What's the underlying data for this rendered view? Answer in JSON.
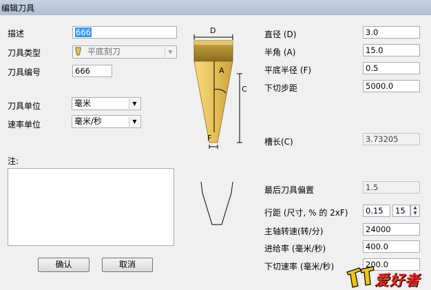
{
  "window": {
    "title": "编辑刀具"
  },
  "left": {
    "desc_label": "描述",
    "desc_value": "666",
    "type_label": "刀具类型",
    "type_value": "平底刻刀",
    "number_label": "刀具编号",
    "number_value": "666",
    "unit_label": "刀具单位",
    "unit_value": "毫米",
    "rate_unit_label": "速率单位",
    "rate_unit_value": "毫米/秒",
    "notes_label": "注:",
    "ok_label": "确认",
    "cancel_label": "取消"
  },
  "diagram": {
    "label_d": "D",
    "label_a": "A",
    "label_c": "C",
    "label_f": "F",
    "colors": {
      "tool_body": "#e8c25a",
      "tool_dark": "#b8962e",
      "line": "#000000"
    }
  },
  "right": {
    "diameter_label": "直径 (D)",
    "diameter_value": "3.0",
    "half_angle_label": "半角 (A)",
    "half_angle_value": "15.0",
    "flat_radius_label": "平底半径 (F)",
    "flat_radius_value": "0.5",
    "plunge_step_label": "下切步距",
    "plunge_step_value": "5000.0",
    "flute_length_label": "槽长(C)",
    "flute_length_value": "3.73205",
    "last_offset_label": "最后刀具偏置",
    "last_offset_value": "1.5",
    "stepover_label": "行距 (尺寸, % 的 2xF)",
    "stepover_value": "0.15",
    "stepover_percent": "15",
    "spindle_label": "主轴转速(转/分)",
    "spindle_value": "24000",
    "feed_label": "进给率 (毫米/秒)",
    "feed_value": "400.0",
    "plunge_rate_label": "下切速率 (毫米/秒)",
    "plunge_rate_value": "200.0"
  },
  "watermark": {
    "text": "爱好者"
  }
}
